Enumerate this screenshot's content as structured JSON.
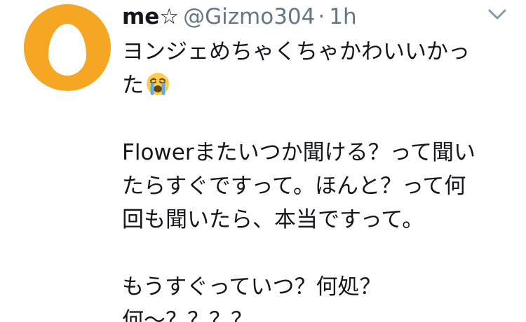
{
  "tweet": {
    "avatar_icon": "default-egg-avatar",
    "avatar_color": "#f5a623",
    "display_name": "me☆",
    "handle": "@Gizmo304",
    "separator": "·",
    "time": "1h",
    "menu_icon": "chevron-down-icon",
    "lines": [
      "ヨンジェめちゃくちゃかわいいかっ",
      "た",
      "Flowerまたいつか聞ける？って聞い",
      "たらすぐですって。ほんと？って何",
      "回も聞いたら、本当ですって。",
      "もうすぐっていつ？何処？",
      "何〜？？？？"
    ],
    "emoji": "loudly-crying-face"
  }
}
